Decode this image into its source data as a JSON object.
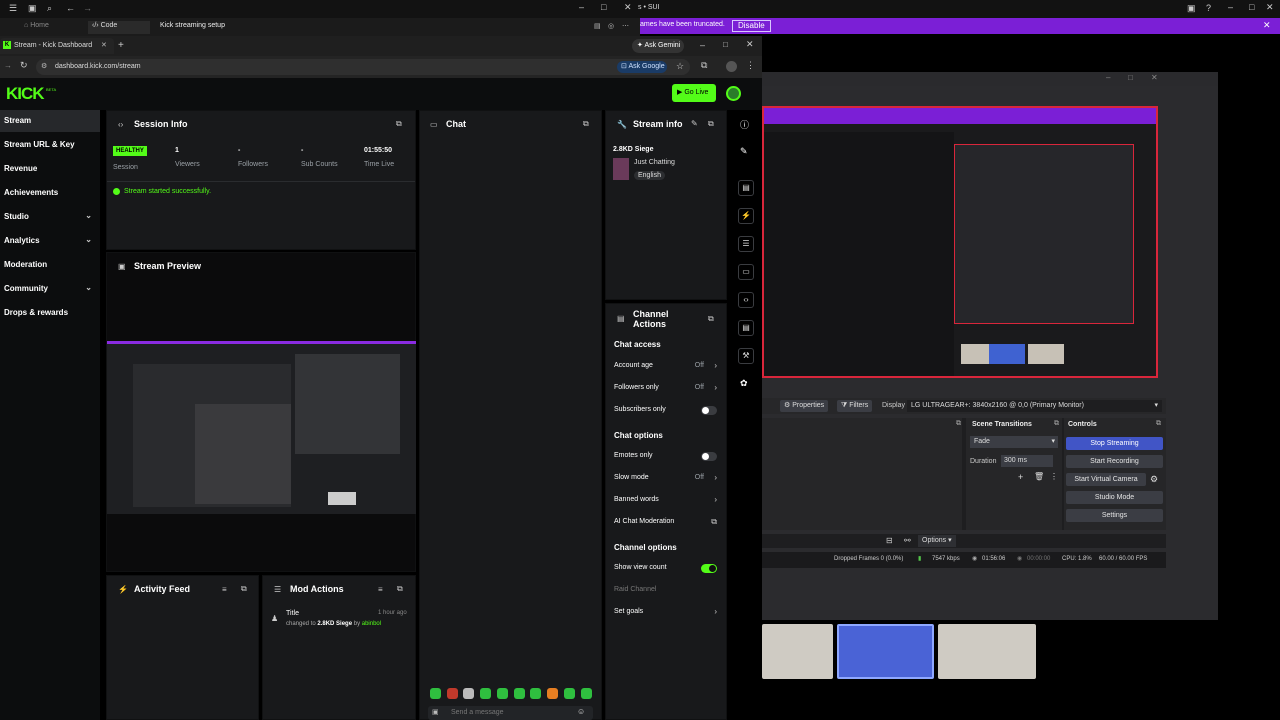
{
  "os_top": {
    "tab1": "Home",
    "tab2": "Code",
    "tab3": "Kick streaming setup",
    "right_title": "s • SUI"
  },
  "notice": {
    "text": "ames have been truncated.",
    "button": "Disable"
  },
  "browser": {
    "tab_title": "Stream - Kick Dashboard",
    "ask_gemini": "Ask Gemini",
    "url": "dashboard.kick.com/stream",
    "ask_google": "Ask Google"
  },
  "kick": {
    "logo": "KICK",
    "logo_sup": "BETA",
    "go_live": "Go Live",
    "accent": "#53fc18"
  },
  "sidebar": {
    "items": [
      {
        "label": "Stream",
        "expandable": false
      },
      {
        "label": "Stream URL & Key",
        "expandable": false
      },
      {
        "label": "Revenue",
        "expandable": false
      },
      {
        "label": "Achievements",
        "expandable": false
      },
      {
        "label": "Studio",
        "expandable": true
      },
      {
        "label": "Analytics",
        "expandable": true
      },
      {
        "label": "Moderation",
        "expandable": false
      },
      {
        "label": "Community",
        "expandable": true
      },
      {
        "label": "Drops & rewards",
        "expandable": false
      }
    ]
  },
  "session": {
    "title": "Session Info",
    "health": "HEALTHY",
    "session_label": "Session",
    "viewers": "1",
    "viewers_label": "Viewers",
    "followers": "-",
    "followers_label": "Followers",
    "subs": "-",
    "subs_label": "Sub Counts",
    "time": "01:55:50",
    "time_label": "Time Live",
    "message": "Stream started successfully."
  },
  "preview": {
    "title": "Stream Preview"
  },
  "activity": {
    "title": "Activity Feed"
  },
  "mod_actions": {
    "title": "Mod Actions",
    "entry_title": "Title",
    "entry_time": "1 hour ago",
    "entry_pre": "changed to",
    "entry_value": "2.8KD Siege",
    "entry_by": "by",
    "entry_user": "abinbol"
  },
  "chat": {
    "title": "Chat",
    "placeholder": "Send a message"
  },
  "stream_info": {
    "title": "Stream info",
    "stream_title": "2.8KD Siege",
    "category": "Just Chatting",
    "language": "English"
  },
  "channel_actions": {
    "title_line1": "Channel",
    "title_line2": "Actions",
    "chat_access": "Chat access",
    "account_age": "Account age",
    "account_age_val": "Off",
    "followers_only": "Followers only",
    "followers_only_val": "Off",
    "subscribers_only": "Subscribers only",
    "chat_options": "Chat options",
    "emotes_only": "Emotes only",
    "slow_mode": "Slow mode",
    "slow_mode_val": "Off",
    "banned_words": "Banned words",
    "ai_mod": "AI Chat Moderation",
    "channel_options": "Channel options",
    "show_view_count": "Show view count",
    "raid_channel": "Raid Channel",
    "set_goals": "Set goals"
  },
  "obs": {
    "properties": "Properties",
    "filters": "Filters",
    "display_label": "Display",
    "display_value": "LG ULTRAGEAR+: 3840x2160 @ 0,0 (Primary Monitor)",
    "scene_transitions": "Scene Transitions",
    "transition": "Fade",
    "duration_label": "Duration",
    "duration_value": "300 ms",
    "controls": "Controls",
    "btn_stop_streaming": "Stop Streaming",
    "btn_start_recording": "Start Recording",
    "btn_virtual_camera": "Start Virtual Camera",
    "btn_studio_mode": "Studio Mode",
    "btn_settings": "Settings",
    "options": "Options",
    "status_dropped": "Dropped Frames 0 (0.0%)",
    "status_kbps": "7547 kbps",
    "status_live": "01:56:06",
    "status_rec": "00:00:00",
    "status_cpu": "CPU: 1.8%",
    "status_fps": "60.00 / 60.00 FPS"
  }
}
